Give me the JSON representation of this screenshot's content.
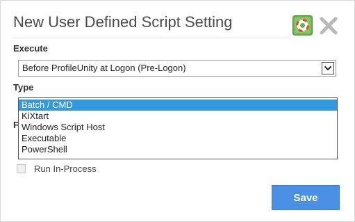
{
  "dialog": {
    "title": "New User Defined Script Setting"
  },
  "icons": {
    "help": "help-icon",
    "close": "close-icon"
  },
  "execute": {
    "label": "Execute",
    "selected": "Before ProfileUnity at Logon (Pre-Logon)"
  },
  "type": {
    "label": "Type",
    "options": [
      "Batch / CMD",
      "KiXtart",
      "Windows Script Host",
      "Executable",
      "PowerShell"
    ],
    "selected_index": 0
  },
  "hidden_field_label": "F",
  "run_in_process": {
    "label": "Run In-Process",
    "checked": false
  },
  "save_label": "Save",
  "colors": {
    "accent": "#4a90e2",
    "selection": "#3399dd",
    "help_green": "#6ab04c"
  }
}
